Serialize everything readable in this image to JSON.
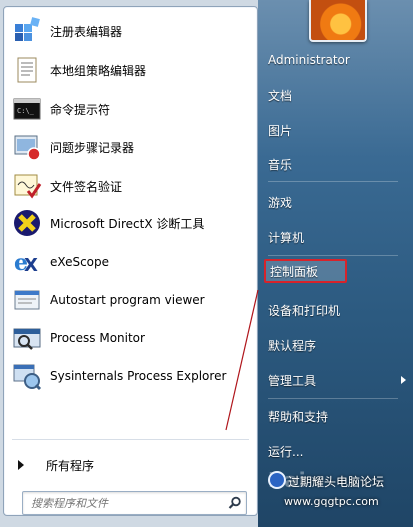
{
  "left_panel": {
    "programs": [
      {
        "label": "注册表编辑器",
        "icon": "registry-editor-icon"
      },
      {
        "label": "本地组策略编辑器",
        "icon": "group-policy-editor-icon"
      },
      {
        "label": "命令提示符",
        "icon": "command-prompt-icon"
      },
      {
        "label": "问题步骤记录器",
        "icon": "steps-recorder-icon"
      },
      {
        "label": "文件签名验证",
        "icon": "file-signature-verification-icon"
      },
      {
        "label": "Microsoft DirectX 诊断工具",
        "icon": "directx-icon"
      },
      {
        "label": "eXeScope",
        "icon": "exescope-icon"
      },
      {
        "label": "Autostart program viewer",
        "icon": "autostart-viewer-icon"
      },
      {
        "label": "Process Monitor",
        "icon": "process-monitor-icon"
      },
      {
        "label": "Sysinternals Process Explorer",
        "icon": "process-explorer-icon"
      }
    ],
    "all_programs_label": "所有程序",
    "search_placeholder": "搜索程序和文件"
  },
  "right_panel": {
    "items": [
      {
        "label": "Administrator"
      },
      {
        "label": "文档"
      },
      {
        "label": "图片"
      },
      {
        "label": "音乐"
      },
      {
        "label": "游戏"
      },
      {
        "label": "计算机"
      },
      {
        "label": "控制面板",
        "highlighted": true
      },
      {
        "label": "设备和打印机"
      },
      {
        "label": "默认程序"
      },
      {
        "label": "管理工具",
        "submenu": true
      },
      {
        "label": "帮助和支持"
      },
      {
        "label": "运行..."
      }
    ]
  },
  "watermark": {
    "text": "过期耀头电脑论坛",
    "url": "www.gqgtpc.com"
  },
  "colors": {
    "highlight_border": "#d8232a",
    "right_panel_bg": "#2c5a80"
  }
}
